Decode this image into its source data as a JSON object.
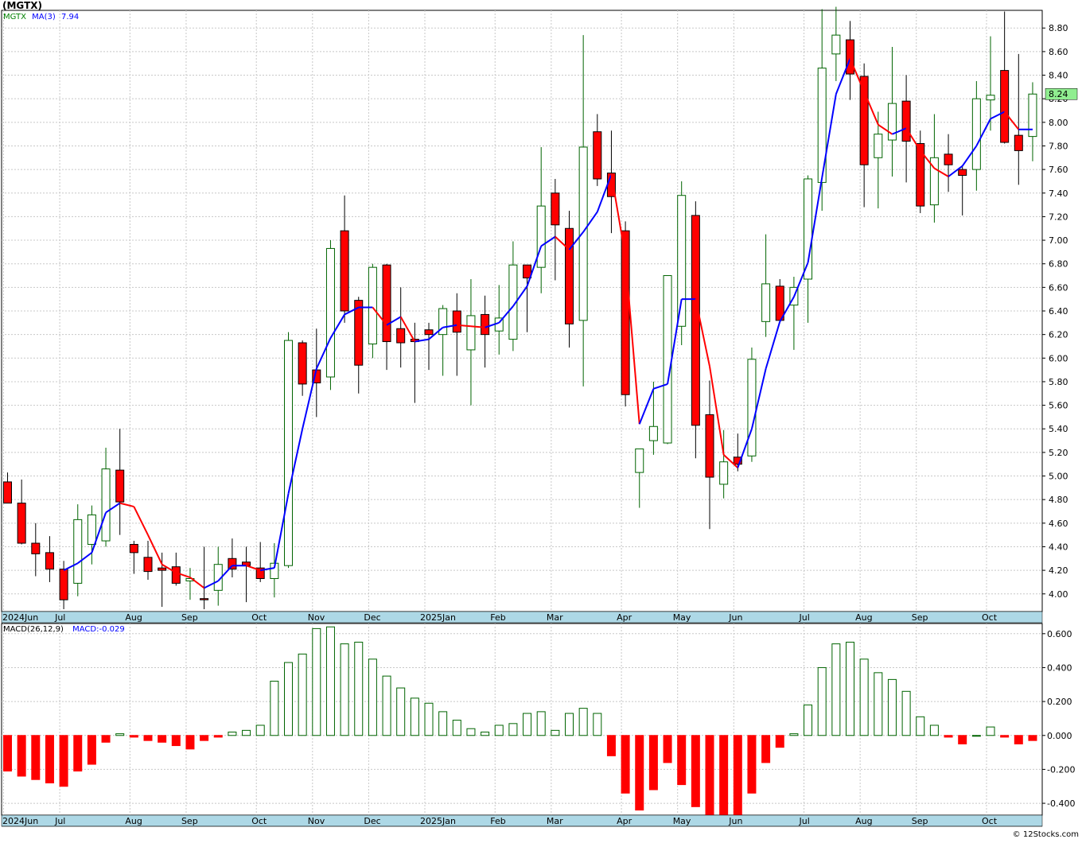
{
  "title": "(MGTX)",
  "credit": "© 12Stocks.com",
  "colors": {
    "up": "#ffffff",
    "up_stroke": "#006400",
    "down": "#ff0000",
    "ma_up": "#0000ff",
    "ma_down": "#ff0000",
    "macd_pos": "#006400",
    "macd_neg": "#ff0000",
    "axis_bar": "#add8e6",
    "grid": "#c8c8c8",
    "last_price": "#90ee90"
  },
  "price_legend": {
    "symbol": "MGTX",
    "ma_label": "MA(3)",
    "ma_value": "7.94"
  },
  "macd_legend": {
    "label": "MACD(26,12,9)",
    "value_label": "MACD:-0.029"
  },
  "last_price_label": "8.24",
  "chart_data": [
    {
      "type": "candlestick",
      "xlabels": [
        "2024Jun",
        "Jul",
        "Aug",
        "Sep",
        "Oct",
        "Nov",
        "Dec",
        "2025Jan",
        "Feb",
        "Mar",
        "Apr",
        "May",
        "Jun",
        "Jul",
        "Aug",
        "Sep",
        "Oct"
      ],
      "xlabel_weeks": [
        0,
        4,
        9,
        13,
        18,
        22,
        26,
        30,
        35,
        39,
        44,
        48,
        52,
        57,
        61,
        65,
        70
      ],
      "yticks": [
        "4.00",
        "4.20",
        "4.40",
        "4.60",
        "4.80",
        "5.00",
        "5.20",
        "5.40",
        "5.60",
        "5.80",
        "6.00",
        "6.20",
        "6.40",
        "6.60",
        "6.80",
        "7.00",
        "7.20",
        "7.40",
        "7.60",
        "7.80",
        "8.00",
        "8.20",
        "8.40",
        "8.60",
        "8.80"
      ],
      "ylim": [
        3.85,
        8.95
      ],
      "grid": true,
      "ohlc": [
        [
          4.95,
          5.03,
          4.78,
          4.77
        ],
        [
          4.77,
          4.97,
          4.42,
          4.43
        ],
        [
          4.43,
          4.6,
          4.15,
          4.34
        ],
        [
          4.35,
          4.49,
          4.1,
          4.21
        ],
        [
          4.21,
          4.28,
          3.87,
          3.95
        ],
        [
          4.09,
          4.76,
          3.98,
          4.63
        ],
        [
          4.42,
          4.75,
          4.25,
          4.67
        ],
        [
          4.45,
          5.24,
          4.4,
          5.06
        ],
        [
          5.05,
          5.4,
          4.5,
          4.78
        ],
        [
          4.42,
          4.45,
          4.17,
          4.35
        ],
        [
          4.31,
          4.45,
          4.12,
          4.19
        ],
        [
          4.22,
          4.35,
          3.89,
          4.2
        ],
        [
          4.23,
          4.35,
          4.07,
          4.09
        ],
        [
          4.11,
          4.22,
          3.95,
          4.13
        ],
        [
          3.96,
          4.4,
          3.87,
          3.95
        ],
        [
          4.03,
          4.4,
          3.9,
          4.25
        ],
        [
          4.3,
          4.47,
          4.14,
          4.21
        ],
        [
          4.27,
          4.4,
          3.93,
          4.24
        ],
        [
          4.22,
          4.44,
          4.1,
          4.13
        ],
        [
          4.13,
          4.43,
          3.97,
          4.26
        ],
        [
          4.24,
          6.22,
          4.22,
          6.15
        ],
        [
          6.13,
          6.15,
          5.68,
          5.78
        ],
        [
          5.9,
          6.25,
          5.5,
          5.79
        ],
        [
          5.84,
          7.0,
          5.73,
          6.93
        ],
        [
          7.08,
          7.38,
          6.3,
          6.4
        ],
        [
          6.49,
          6.52,
          5.7,
          5.94
        ],
        [
          6.12,
          6.8,
          6.0,
          6.77
        ],
        [
          6.79,
          6.8,
          5.9,
          6.14
        ],
        [
          6.25,
          6.6,
          5.92,
          6.13
        ],
        [
          6.16,
          6.3,
          5.62,
          6.14
        ],
        [
          6.24,
          6.3,
          5.9,
          6.2
        ],
        [
          6.2,
          6.45,
          5.85,
          6.42
        ],
        [
          6.4,
          6.55,
          5.85,
          6.22
        ],
        [
          6.07,
          6.67,
          5.6,
          6.36
        ],
        [
          6.37,
          6.53,
          5.92,
          6.2
        ],
        [
          6.23,
          6.62,
          6.03,
          6.34
        ],
        [
          6.16,
          6.99,
          6.06,
          6.79
        ],
        [
          6.79,
          6.79,
          6.22,
          6.68
        ],
        [
          6.77,
          7.79,
          6.55,
          7.29
        ],
        [
          7.4,
          7.52,
          6.66,
          7.13
        ],
        [
          7.1,
          7.25,
          6.09,
          6.29
        ],
        [
          6.32,
          8.74,
          5.76,
          7.79
        ],
        [
          7.92,
          8.07,
          7.46,
          7.52
        ],
        [
          7.57,
          7.93,
          7.06,
          7.37
        ],
        [
          7.08,
          7.16,
          5.59,
          5.69
        ],
        [
          5.03,
          5.22,
          4.73,
          5.23
        ],
        [
          5.3,
          5.8,
          5.18,
          5.42
        ],
        [
          5.28,
          6.7,
          5.27,
          6.7
        ],
        [
          6.27,
          7.5,
          6.11,
          7.38
        ],
        [
          7.21,
          7.33,
          5.15,
          5.43
        ],
        [
          5.52,
          5.81,
          4.55,
          4.99
        ],
        [
          4.93,
          5.39,
          4.81,
          5.12
        ],
        [
          5.16,
          5.36,
          5.04,
          5.1
        ],
        [
          5.17,
          6.09,
          5.12,
          5.99
        ],
        [
          6.31,
          7.05,
          6.18,
          6.63
        ],
        [
          6.61,
          6.67,
          6.33,
          6.32
        ],
        [
          6.45,
          6.69,
          6.07,
          6.6
        ],
        [
          6.67,
          7.55,
          6.3,
          7.52
        ],
        [
          7.49,
          8.96,
          7.25,
          8.46
        ],
        [
          8.58,
          8.98,
          8.35,
          8.74
        ],
        [
          8.7,
          8.86,
          8.19,
          8.41
        ],
        [
          8.39,
          8.5,
          7.28,
          7.64
        ],
        [
          7.7,
          8.09,
          7.27,
          7.9
        ],
        [
          7.85,
          8.64,
          7.54,
          8.16
        ],
        [
          8.18,
          8.4,
          7.49,
          7.84
        ],
        [
          7.82,
          7.93,
          7.23,
          7.29
        ],
        [
          7.3,
          8.07,
          7.15,
          7.7
        ],
        [
          7.73,
          7.9,
          7.41,
          7.64
        ],
        [
          7.6,
          7.63,
          7.21,
          7.55
        ],
        [
          7.6,
          8.35,
          7.42,
          8.2
        ],
        [
          8.19,
          8.73,
          7.93,
          8.23
        ],
        [
          8.44,
          8.94,
          7.82,
          7.83
        ],
        [
          7.89,
          8.58,
          7.47,
          7.76
        ],
        [
          7.88,
          8.34,
          7.67,
          8.24
        ]
      ],
      "ma3": [
        null,
        null,
        null,
        null,
        4.2,
        4.26,
        4.35,
        4.69,
        4.77,
        4.74,
        4.5,
        4.25,
        4.18,
        4.14,
        4.05,
        4.11,
        4.24,
        4.24,
        4.2,
        4.22,
        4.85,
        5.4,
        5.91,
        6.17,
        6.37,
        6.43,
        6.43,
        6.28,
        6.35,
        6.14,
        6.16,
        6.26,
        6.28,
        6.27,
        6.26,
        6.3,
        6.44,
        6.61,
        6.95,
        7.03,
        6.92,
        7.07,
        7.24,
        7.56,
        6.86,
        5.44,
        5.74,
        5.78,
        6.5,
        6.5,
        5.93,
        5.18,
        5.07,
        5.4,
        5.91,
        6.31,
        6.52,
        6.81,
        7.53,
        8.24,
        8.54,
        8.26,
        7.98,
        7.9,
        7.95,
        7.76,
        7.61,
        7.54,
        7.63,
        7.8,
        8.03,
        8.09,
        7.94,
        7.94
      ],
      "series": [
        {
          "name": "MA(3)",
          "values_ref": "ma3"
        }
      ]
    },
    {
      "type": "bar",
      "yticks": [
        "-0.400",
        "-0.200",
        "0.000",
        "0.200",
        "0.400",
        "0.600"
      ],
      "ylim": [
        -0.47,
        0.66
      ],
      "values": [
        -0.21,
        -0.24,
        -0.26,
        -0.28,
        -0.3,
        -0.21,
        -0.17,
        -0.04,
        0.01,
        -0.01,
        -0.03,
        -0.04,
        -0.06,
        -0.08,
        -0.03,
        -0.01,
        0.02,
        0.03,
        0.06,
        0.32,
        0.43,
        0.48,
        0.63,
        0.64,
        0.54,
        0.55,
        0.45,
        0.35,
        0.28,
        0.22,
        0.19,
        0.14,
        0.09,
        0.04,
        0.02,
        0.06,
        0.07,
        0.13,
        0.14,
        0.03,
        0.13,
        0.16,
        0.13,
        -0.12,
        -0.34,
        -0.44,
        -0.32,
        -0.16,
        -0.29,
        -0.42,
        -0.47,
        -0.47,
        -0.47,
        -0.34,
        -0.16,
        -0.07,
        0.01,
        0.18,
        0.4,
        0.54,
        0.55,
        0.45,
        0.37,
        0.33,
        0.26,
        0.11,
        0.06,
        -0.01,
        -0.05,
        0.0,
        0.05,
        -0.01,
        -0.05,
        -0.03
      ],
      "series": [
        {
          "name": "MACD(26,12,9)"
        }
      ]
    }
  ]
}
